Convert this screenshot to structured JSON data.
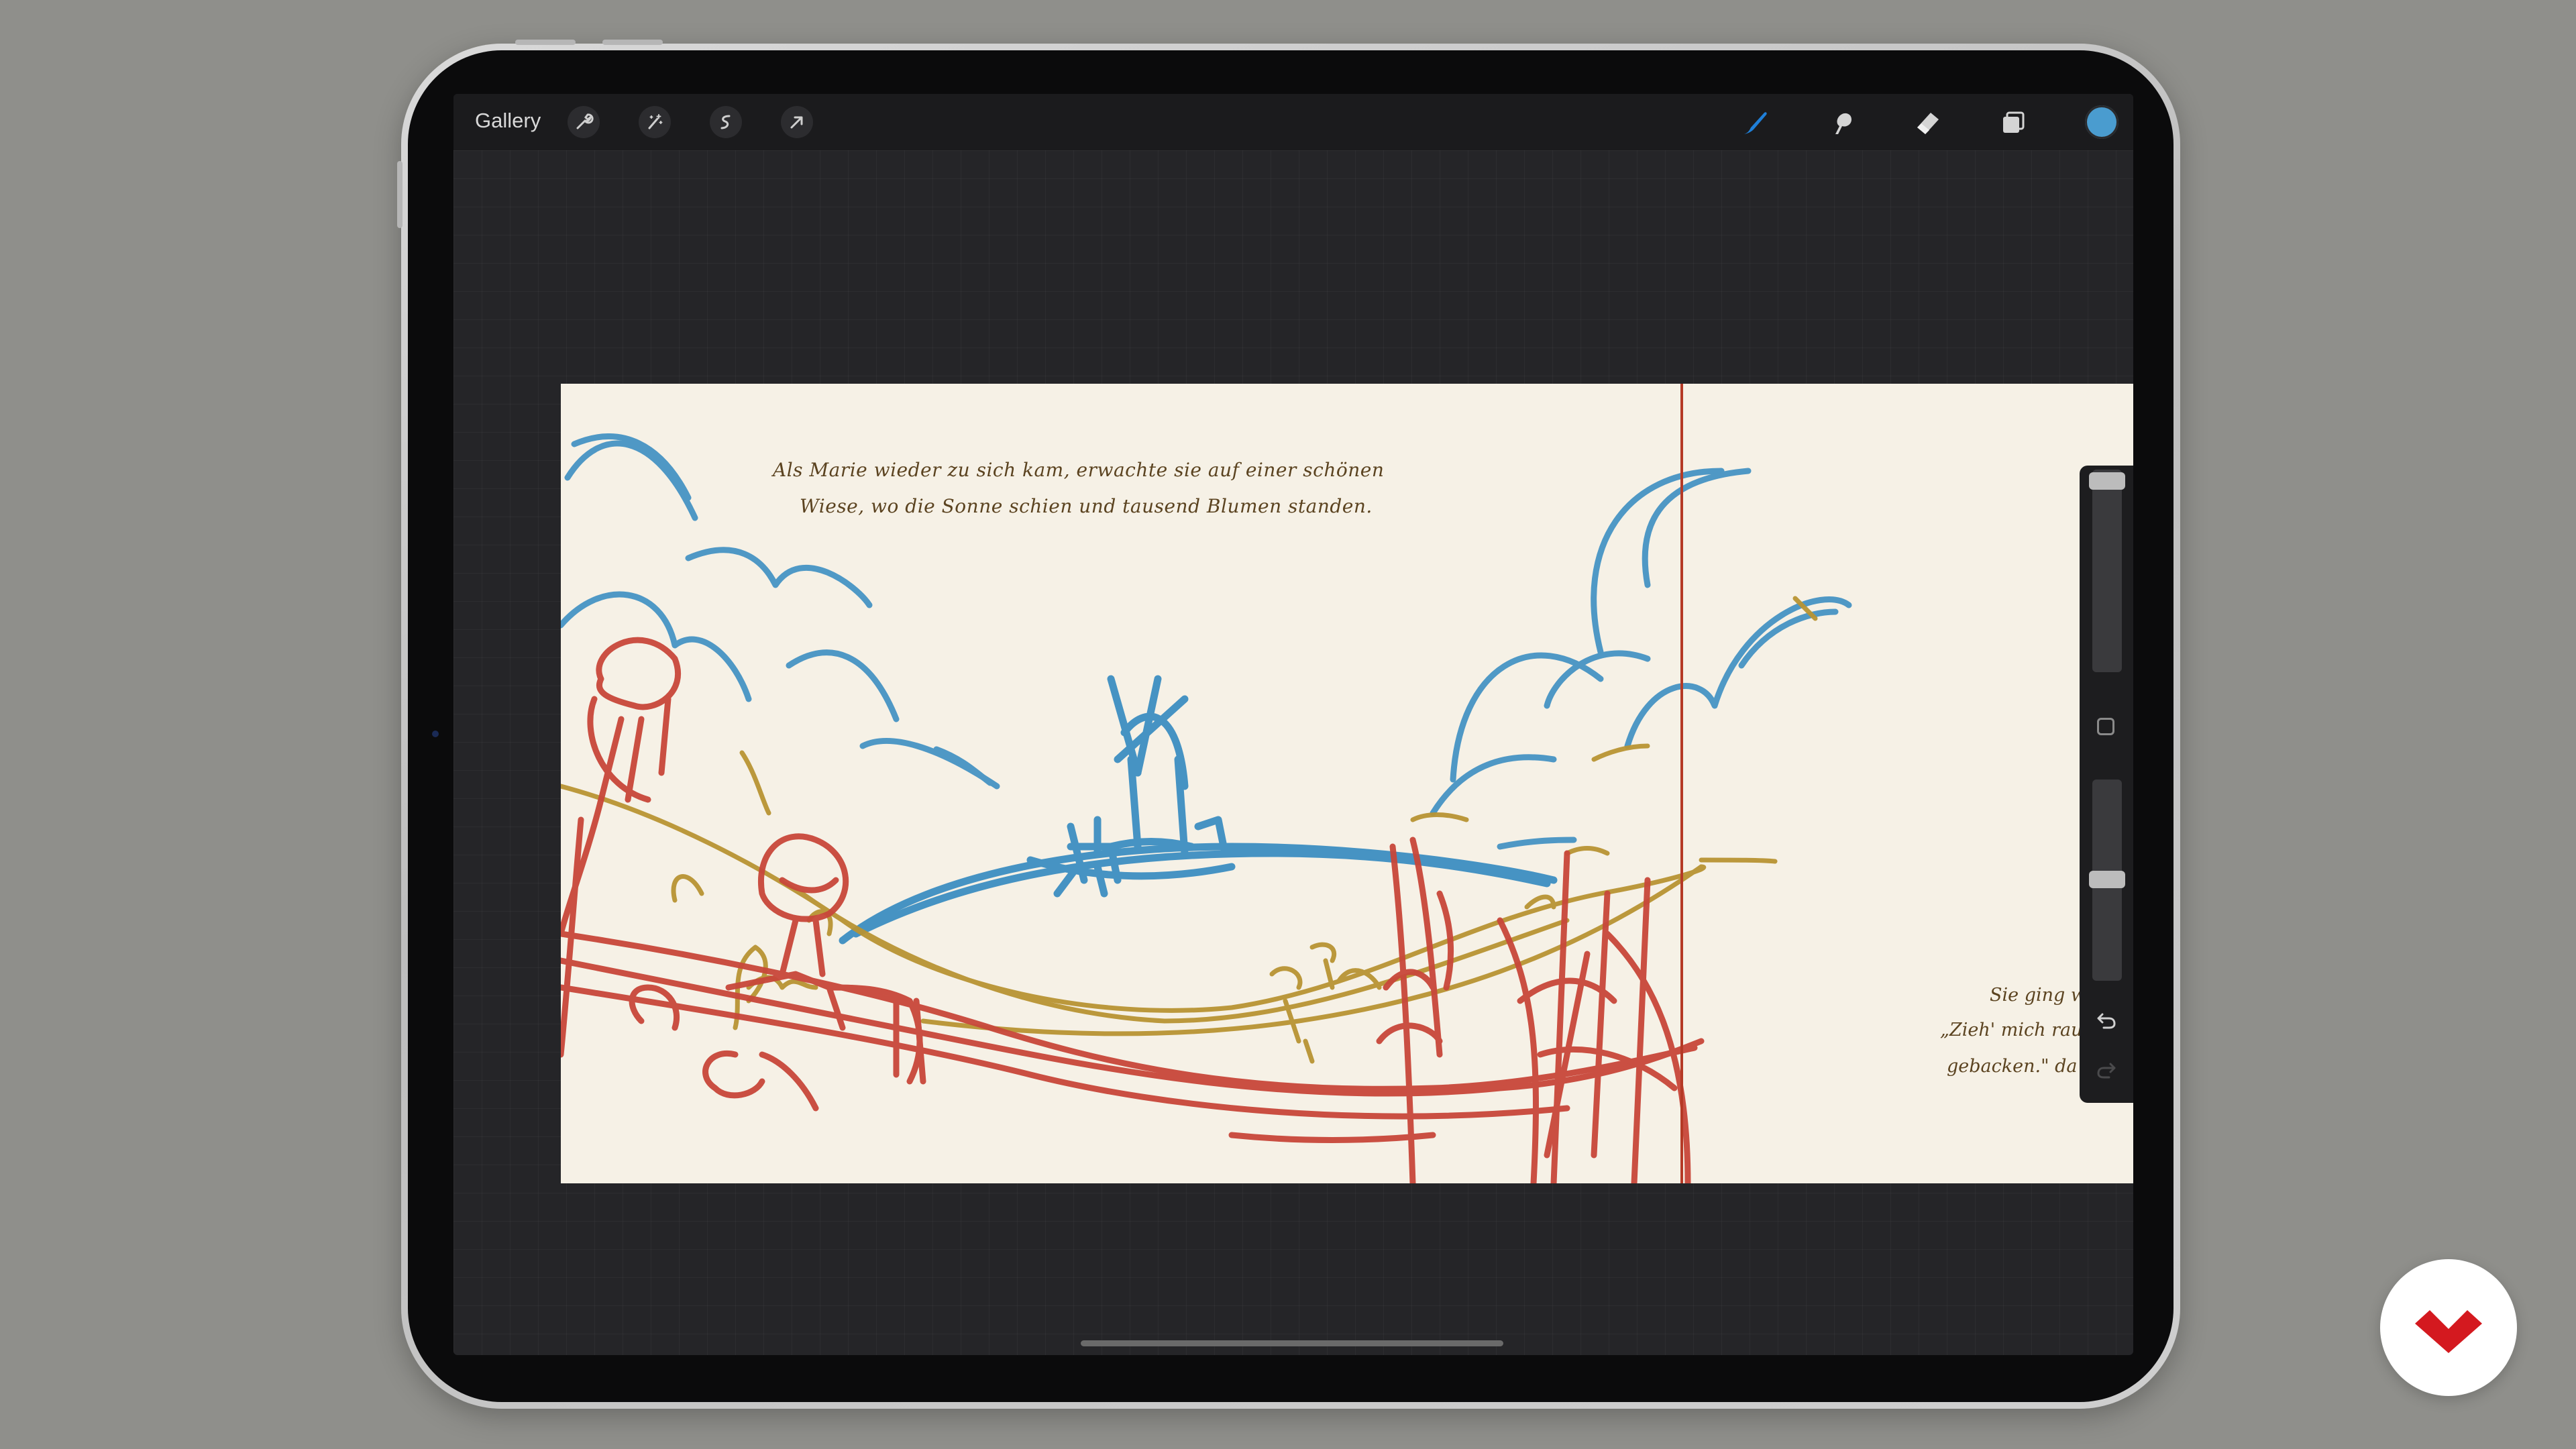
{
  "app": {
    "gallery_label": "Gallery",
    "accent_color": "#1f7fd8",
    "current_color": "#4a9ccf"
  },
  "toolbar": {
    "left_tools": [
      "wrench-icon",
      "magic-wand-icon",
      "selection-icon",
      "transform-arrow-icon"
    ],
    "right_tools": [
      "brush-icon",
      "smudge-icon",
      "eraser-icon",
      "layers-icon",
      "color-swatch"
    ]
  },
  "canvas": {
    "story_text": {
      "line1": "Als Marie wieder zu sich kam, erwachte sie auf einer schönen",
      "line2": "Wiese, wo die Sonne schien und tausend Blumen standen."
    },
    "next_page_text": {
      "line1": "Sie ging w",
      "line2": "„Zieh' mich rau",
      "line3": "gebacken.\" da"
    },
    "sketch_colors": {
      "blue": "#3d8fc2",
      "red": "#c8473a",
      "ochre": "#b89433",
      "paper": "#f6f1e6"
    }
  },
  "side_panel": {
    "brush_size_level": 0.02,
    "opacity_level": 0.45,
    "undo_icon": "undo-icon",
    "redo_icon": "redo-icon"
  }
}
